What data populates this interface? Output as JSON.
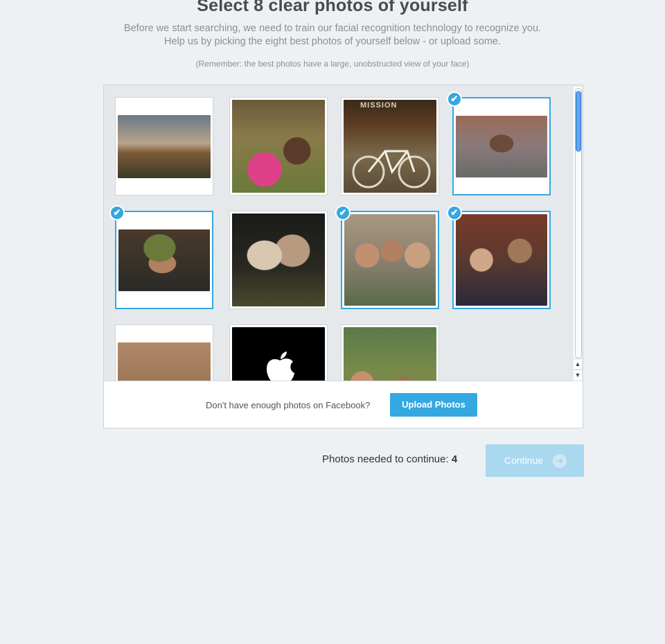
{
  "page": {
    "title": "Select 8 clear photos of yourself",
    "intro_line1": "Before we start searching, we need to train our facial recognition technology to recognize you.",
    "intro_line2": "Help us by picking the eight best photos of yourself below - or upload some.",
    "reminder": "(Remember: the best photos have a large, unobstructed view of your face)"
  },
  "photos": [
    {
      "selected": false
    },
    {
      "selected": false
    },
    {
      "selected": false,
      "caption": "MISSION"
    },
    {
      "selected": true
    },
    {
      "selected": true
    },
    {
      "selected": false
    },
    {
      "selected": true
    },
    {
      "selected": true
    },
    {
      "selected": false
    },
    {
      "selected": false
    },
    {
      "selected": false
    }
  ],
  "footer": {
    "prompt": "Don't have enough photos on Facebook?",
    "upload_label": "Upload Photos"
  },
  "progress": {
    "needed_label": "Photos needed to continue:",
    "needed_count": "4",
    "continue_label": "Continue"
  },
  "icons": {
    "check": "check-icon",
    "arrow": "arrow-right-icon"
  },
  "colors": {
    "accent": "#34a8e0",
    "continue_disabled": "#a9d8ef",
    "background": "#edf1f4"
  }
}
